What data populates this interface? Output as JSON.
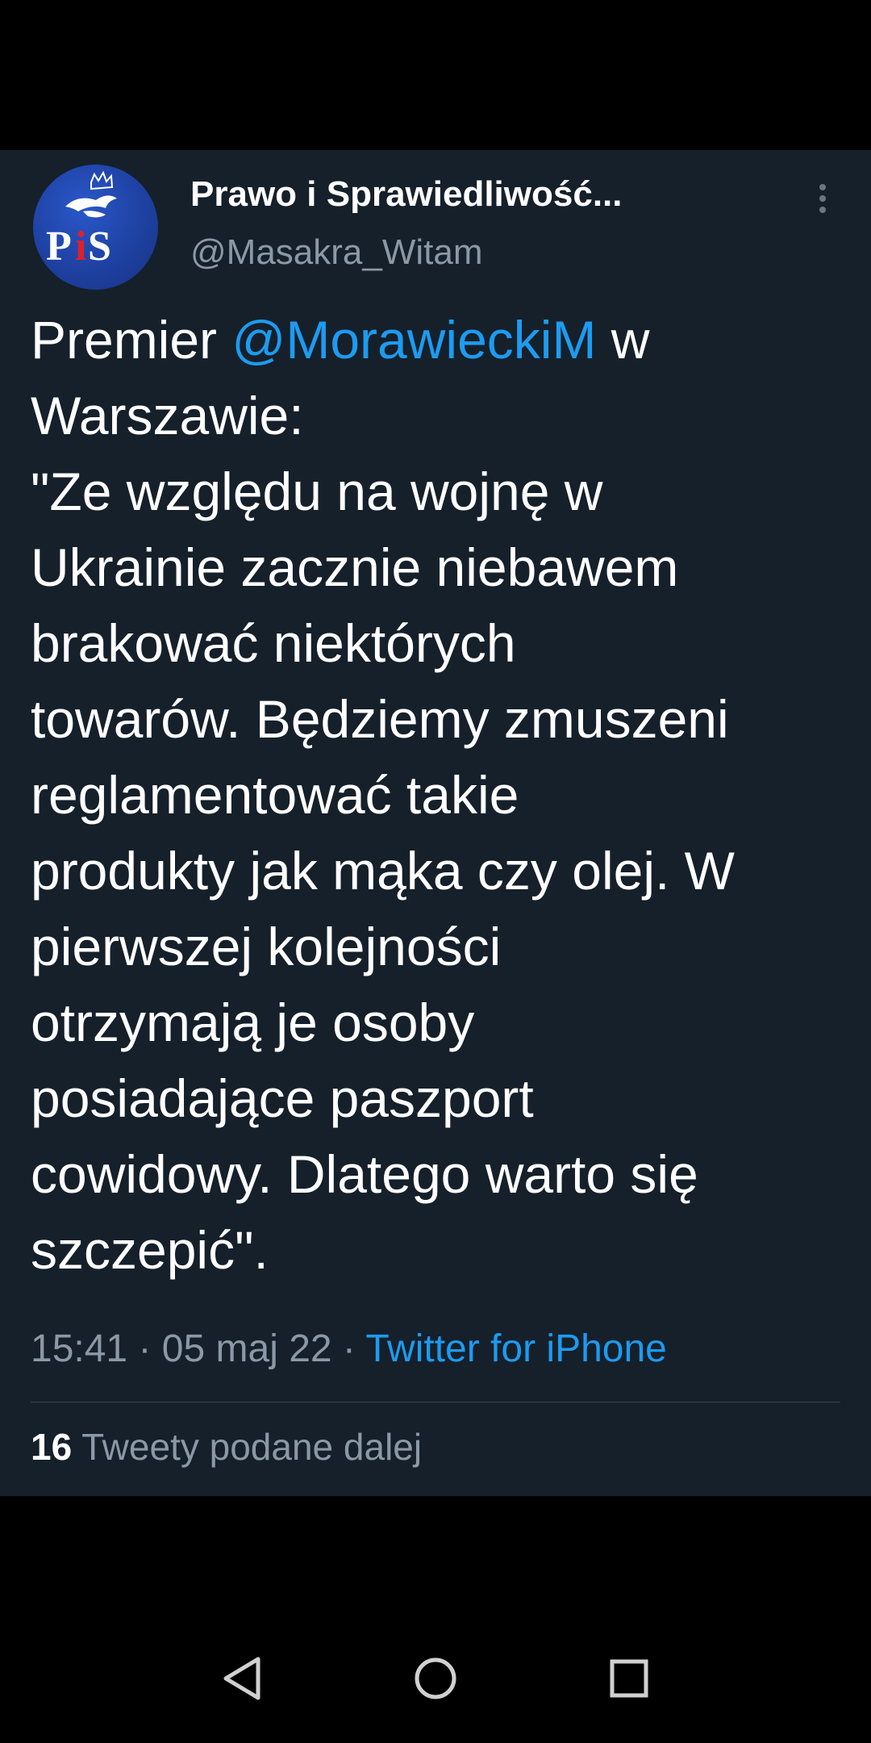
{
  "tweet": {
    "author_name": "Prawo i Sprawiedliwość...",
    "author_handle": "@Masakra_Witam",
    "avatar_text": "PiS",
    "text_parts": {
      "before_mention": "Premier ",
      "mention": "@MorawieckiM",
      "after_mention": " w\nWarszawie:\n\"Ze względu na wojnę w\nUkrainie zacznie niebawem\nbrakować niektórych\ntowarów. Będziemy zmuszeni\nreglamentować takie\nprodukty jak mąka czy olej. W\npierwszej kolejności\notrzymają je osoby\nposiadające paszport\ncowidowy. Dlatego warto się\nszczepić\"."
    },
    "time": "15:41",
    "separator": " · ",
    "date": "05 maj 22",
    "source": "Twitter for iPhone",
    "retweet_count": "16",
    "retweet_label": " Tweety podane dalej"
  },
  "navigation": {
    "back_icon": "back-triangle-icon",
    "home_icon": "home-circle-icon",
    "recents_icon": "recents-square-icon"
  },
  "colors": {
    "background": "#000000",
    "card": "#15202b",
    "link": "#1d9bf0",
    "muted": "#8b98a5"
  }
}
